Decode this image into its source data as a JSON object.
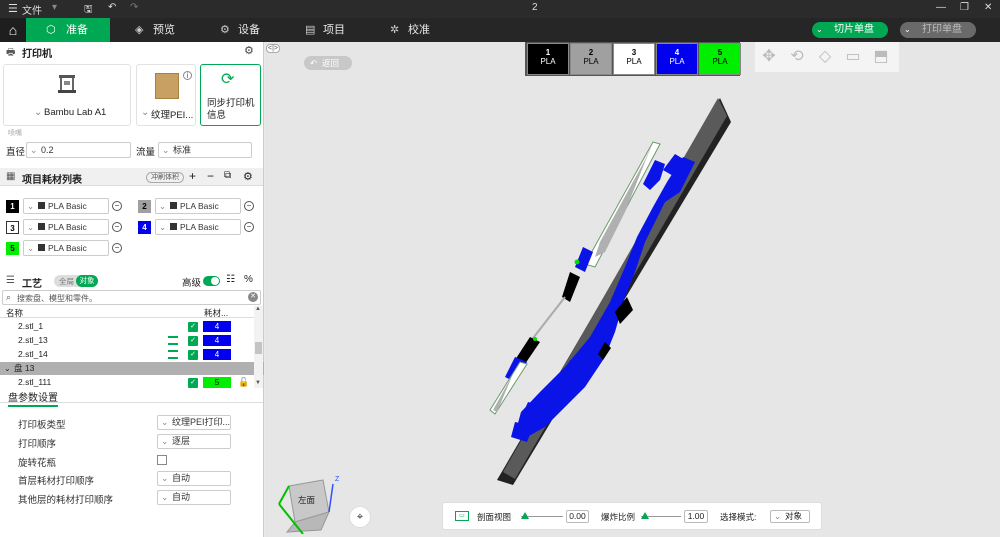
{
  "titlebar": {
    "file_menu": "文件",
    "title": "2"
  },
  "topnav": {
    "tabs": [
      {
        "label": "准备",
        "icon": "box-icon"
      },
      {
        "label": "预览",
        "icon": "layers-icon"
      },
      {
        "label": "设备",
        "icon": "device-icon"
      },
      {
        "label": "项目",
        "icon": "project-icon"
      },
      {
        "label": "校准",
        "icon": "calibrate-icon"
      }
    ],
    "slice_button": "切片单盘",
    "print_button": "打印单盘"
  },
  "printer": {
    "section_title": "打印机",
    "printer_name": "Bambu Lab A1",
    "plate_name": "纹理PEI...",
    "sync_label_line1": "同步打印机",
    "sync_label_line2": "信息",
    "nozzle_label": "喷嘴",
    "diameter_label": "直径",
    "diameter_value": "0.2",
    "flow_label": "流量",
    "flow_value": "标准"
  },
  "filaments": {
    "section_title": "项目耗材列表",
    "flush_button": "冲刷体积",
    "items": [
      {
        "num": "1",
        "name": "PLA Basic",
        "color": "#000000",
        "text": "#ffffff"
      },
      {
        "num": "2",
        "name": "PLA Basic",
        "color": "#a0a0a0",
        "text": "#000000"
      },
      {
        "num": "3",
        "name": "PLA Basic",
        "color": "#ffffff",
        "text": "#000000"
      },
      {
        "num": "4",
        "name": "PLA Basic",
        "color": "#0000ee",
        "text": "#ffffff"
      },
      {
        "num": "5",
        "name": "PLA Basic",
        "color": "#00ee00",
        "text": "#000000"
      }
    ]
  },
  "process": {
    "section_title": "工艺",
    "toggle_global": "全局",
    "toggle_object": "对象",
    "advanced_label": "高级",
    "search_placeholder": "搜索盘、模型和零件。",
    "col_name": "名称",
    "col_filament": "耗材...",
    "rows": [
      {
        "name": "2.stl_1",
        "fil": "4",
        "color": "#0000ee",
        "layers": false
      },
      {
        "name": "2.stl_13",
        "fil": "4",
        "color": "#0000ee",
        "layers": true
      },
      {
        "name": "2.stl_14",
        "fil": "4",
        "color": "#0000ee",
        "layers": true
      }
    ],
    "group_label": "盘 13",
    "last_row": {
      "name": "2.stl_111",
      "fil": "5",
      "color": "#00ee00"
    }
  },
  "plate_settings": {
    "tab_label": "盘参数设置",
    "bed_type_label": "打印板类型",
    "bed_type_value": "纹理PEI打印...",
    "print_seq_label": "打印顺序",
    "print_seq_value": "逐层",
    "spiral_label": "旋转花瓶",
    "first_layer_label": "首层耗材打印顺序",
    "first_layer_value": "自动",
    "other_layer_label": "其他层的耗材打印顺序",
    "other_layer_value": "自动"
  },
  "viewport": {
    "return_button": "返回",
    "color_boxes": [
      {
        "num": "1",
        "mat": "PLA",
        "color": "#000000",
        "text": "#ffffff"
      },
      {
        "num": "2",
        "mat": "PLA",
        "color": "#a0a0a0",
        "text": "#000000"
      },
      {
        "num": "3",
        "mat": "PLA",
        "color": "#ffffff",
        "text": "#000000"
      },
      {
        "num": "4",
        "mat": "PLA",
        "color": "#0000ee",
        "text": "#ffffff"
      },
      {
        "num": "5",
        "mat": "PLA",
        "color": "#00ee00",
        "text": "#000000"
      }
    ],
    "cube_label": "左面",
    "cube_axis_z": "Z",
    "bottom": {
      "section_view": "剖面视图",
      "section_value": "0.00",
      "explode_label": "爆炸比例",
      "explode_value": "1.00",
      "select_mode_label": "选择模式:",
      "select_mode_value": "对象"
    }
  }
}
